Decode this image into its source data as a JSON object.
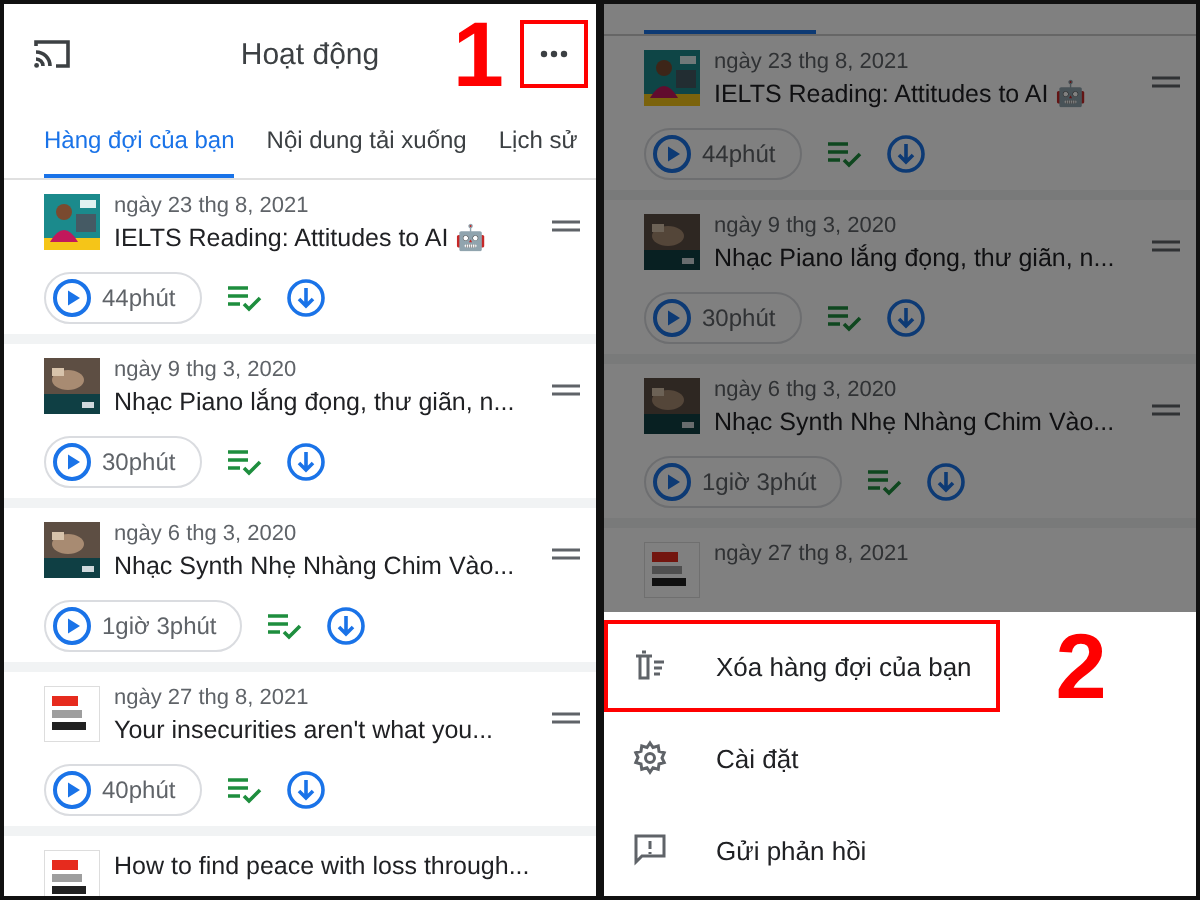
{
  "left_screen": {
    "header": {
      "title": "Hoạt động",
      "step_label": "1",
      "more_highlighted": true
    },
    "tabs": [
      {
        "label": "Hàng đợi của bạn",
        "selected": true
      },
      {
        "label": "Nội dung tải xuống",
        "selected": false
      },
      {
        "label": "Lịch sử",
        "selected": false
      }
    ],
    "episodes": [
      {
        "kind": "ielts",
        "date": "ngày 23 thg 8, 2021",
        "title": "IELTS Reading: Attitudes to AI 🤖",
        "duration": "44phút"
      },
      {
        "kind": "piano",
        "date": "ngày 9 thg 3, 2020",
        "title": "Nhạc Piano lắng đọng, thư giãn, n...",
        "duration": "30phút"
      },
      {
        "kind": "piano",
        "date": "ngày 6 thg 3, 2020",
        "title": "Nhạc Synth Nhẹ Nhàng Chim Vào...",
        "duration": "1giờ 3phút"
      },
      {
        "kind": "ted",
        "date": "ngày 27 thg 8, 2021",
        "title": "Your insecurities aren't what you...",
        "duration": "40phút"
      }
    ],
    "partial_episode": {
      "kind": "ted",
      "title": "How to find peace with loss through..."
    }
  },
  "right_screen": {
    "episodes": [
      {
        "kind": "ielts",
        "date": "ngày 23 thg 8, 2021",
        "title": "IELTS Reading: Attitudes to AI 🤖",
        "duration": "44phút"
      },
      {
        "kind": "piano",
        "date": "ngày 9 thg 3, 2020",
        "title": "Nhạc Piano lắng đọng, thư giãn, n...",
        "duration": "30phút"
      },
      {
        "kind": "piano",
        "date": "ngày 6 thg 3, 2020",
        "title": "Nhạc Synth Nhẹ Nhàng Chim Vào...",
        "duration": "1giờ 3phút"
      }
    ],
    "partial_episode": {
      "kind": "ted",
      "date": "ngày 27 thg 8, 2021"
    },
    "menu": {
      "step_label": "2",
      "items": [
        {
          "kind": "clear",
          "label": "Xóa hàng đợi của bạn",
          "highlighted": true
        },
        {
          "kind": "settings",
          "label": "Cài đặt",
          "highlighted": false
        },
        {
          "kind": "feedback",
          "label": "Gửi phản hồi",
          "highlighted": false
        }
      ]
    }
  }
}
